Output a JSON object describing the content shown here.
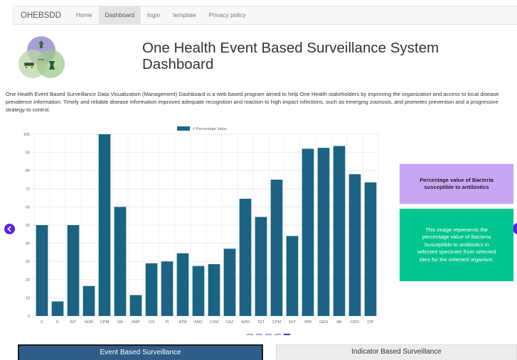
{
  "nav": {
    "brand": "OHEBSDD",
    "items": [
      {
        "label": "Home",
        "active": false
      },
      {
        "label": "Dashboard",
        "active": true
      },
      {
        "label": "login",
        "active": false
      },
      {
        "label": "template",
        "active": false
      },
      {
        "label": "Privacy policy",
        "active": false
      }
    ]
  },
  "header": {
    "title": "One Health Event Based Surveillance System Dashboard",
    "intro": "One Health Event Based Surveillance Data Visualization (Management) Dashboard is a web based program aimed to help One Health stakeholders by improving the organization and access to local disease prevalence information. Timely and reliable disease information improves adequate recognition and reaction to high impact infections, such as emerging zoonosis, and promotes prevention and a progressive strategy to control."
  },
  "chart_data": {
    "type": "bar",
    "categories": [
      "C",
      "E",
      "NIT",
      "NOR",
      "CPM",
      "NA",
      "AMP",
      "CN",
      "PI",
      "ATM",
      "AMC",
      "CXM",
      "CAZ",
      "AZM",
      "TET",
      "CPM",
      "SXT",
      "IPM",
      "GEN",
      "AK",
      "CRO",
      "CIP"
    ],
    "series": [
      {
        "name": "# Percentage Value",
        "values": [
          50,
          8,
          50,
          16.5,
          100,
          60,
          11.5,
          29,
          30,
          34.5,
          27.5,
          28.5,
          37,
          64.5,
          54.5,
          75,
          44,
          92,
          92.5,
          93.5,
          78,
          73.5
        ]
      }
    ],
    "ylim": [
      0,
      100
    ],
    "yticks": [
      0,
      10,
      20,
      30,
      40,
      50,
      60,
      70,
      80,
      90,
      100
    ],
    "legend_position": "top",
    "grid": true,
    "bar_color": "#1c6383"
  },
  "carousel": {
    "slide_count": 5,
    "active_index": 4,
    "accent_color": "#5b21e6",
    "prev_icon": "chevron-left-icon",
    "next_icon": "chevron-right-icon"
  },
  "cards": {
    "title": "Percentage value of Bacteria susceptible to antibiotics",
    "description": "This image represents the percentage value of Bacteria Susceptible to antibiotics in selected specimen from selected sites for the selected organism."
  },
  "buttons": {
    "ebs": "Event Based Surveillance",
    "ibs": "Indicator Based Surveillance"
  },
  "colors": {
    "title_card": "#c9a5f5",
    "desc_card": "#00c58f",
    "ebs_button": "#2d5d88"
  }
}
